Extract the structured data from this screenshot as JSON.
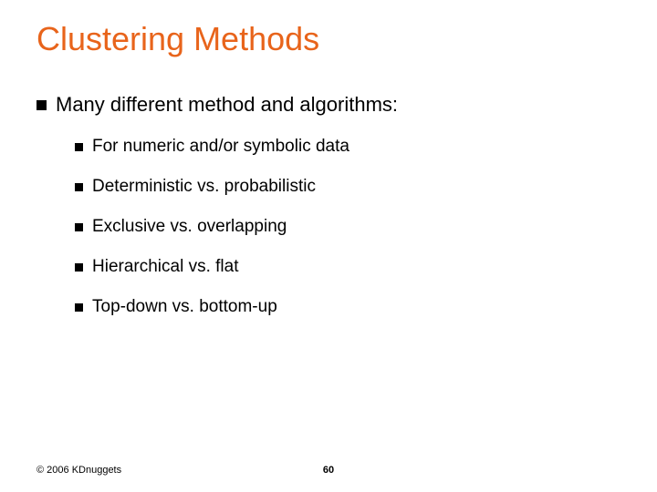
{
  "title": "Clustering Methods",
  "main_bullet": "Many different method and algorithms:",
  "sub_bullets": [
    "For numeric and/or symbolic data",
    "Deterministic vs. probabilistic",
    "Exclusive vs. overlapping",
    "Hierarchical vs. flat",
    "Top-down vs. bottom-up"
  ],
  "footer": "© 2006 KDnuggets",
  "page_number": "60"
}
